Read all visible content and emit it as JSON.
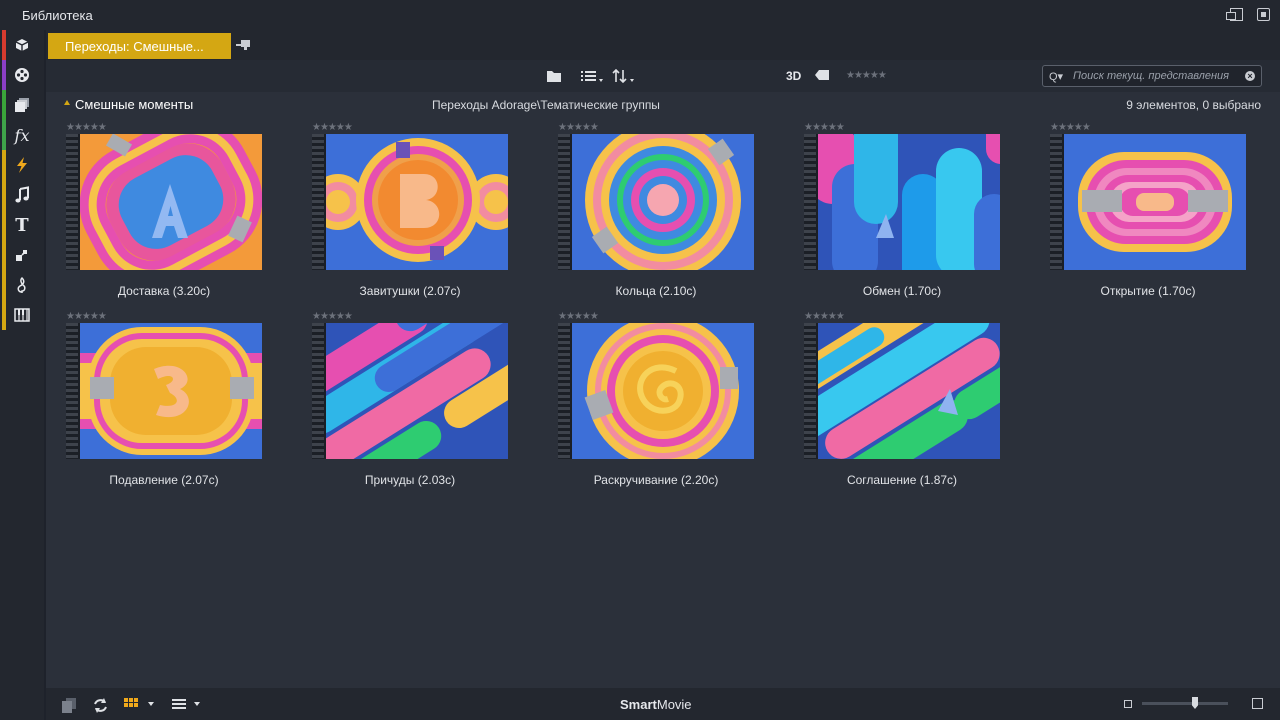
{
  "window": {
    "title": "Библиотека"
  },
  "tab": {
    "label": "Переходы: Смешные..."
  },
  "toolbar": {
    "label_3d": "3D",
    "stars": "★★★★★"
  },
  "search": {
    "placeholder": "Поиск текущ. представления"
  },
  "group": {
    "name": "Смешные моменты",
    "path": "Переходы Adorage\\Тематические группы",
    "count": "9 элементов, 0 выбрано"
  },
  "sidebar": {
    "items": [
      {
        "name": "box-icon",
        "color": "#d63b2f"
      },
      {
        "name": "film-reel-icon",
        "color": "#8b3fc4"
      },
      {
        "name": "stack-icon",
        "color": "#3aa53a"
      },
      {
        "name": "fx-icon",
        "color": "#3fa34a"
      },
      {
        "name": "transition-icon",
        "color": "#d4a713"
      },
      {
        "name": "music-note-icon",
        "color": "#d4a713"
      },
      {
        "name": "title-icon",
        "color": "#d4a713"
      },
      {
        "name": "montage-icon",
        "color": "#d4a713"
      },
      {
        "name": "score-icon",
        "color": "#d4a713"
      },
      {
        "name": "piano-icon",
        "color": "#d4a713"
      }
    ]
  },
  "items": [
    {
      "name": "Доставка (3.20с)",
      "stars": "★★★★★",
      "art": "A"
    },
    {
      "name": "Завитушки (2.07с)",
      "stars": "★★★★★",
      "art": "B"
    },
    {
      "name": "Кольца (2.10с)",
      "stars": "★★★★★",
      "art": "rings"
    },
    {
      "name": "Обмен (1.70с)",
      "stars": "★★★★★",
      "art": "pills"
    },
    {
      "name": "Открытие (1.70с)",
      "stars": "★★★★★",
      "art": "tunnel"
    },
    {
      "name": "Подавление (2.07с)",
      "stars": "★★★★★",
      "art": "tunnel-orange"
    },
    {
      "name": "Причуды (2.03с)",
      "stars": "★★★★★",
      "art": "diag"
    },
    {
      "name": "Раскручивание (2.20с)",
      "stars": "★★★★★",
      "art": "swirl"
    },
    {
      "name": "Соглашение (1.87с)",
      "stars": "★★★★★",
      "art": "diag-green"
    }
  ],
  "bottom": {
    "brand_bold": "Smart",
    "brand_regular": "Movie"
  },
  "colors": {
    "accent": "#d4a713",
    "background": "#2b303a",
    "thumb_blue": "#3d6fd8"
  }
}
